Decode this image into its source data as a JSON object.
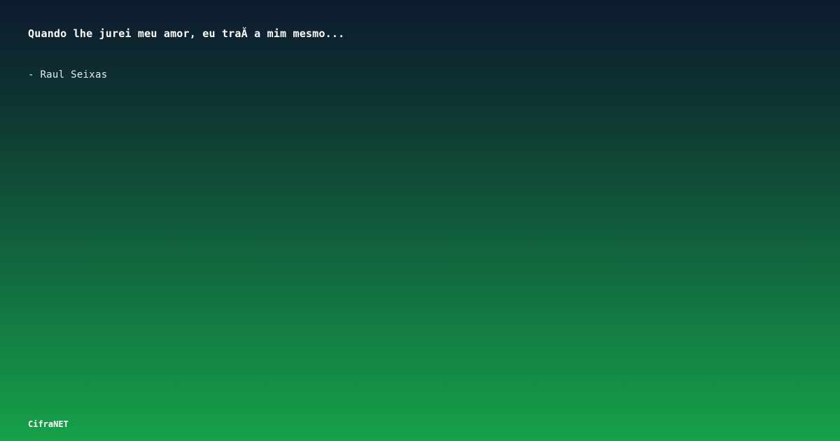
{
  "quote": {
    "text": "Quando lhe jurei meu amor, eu traĂ­ a mim mesmo..."
  },
  "author": {
    "text": "- Raul Seixas"
  },
  "brand": {
    "name": "CifraNET"
  },
  "colors": {
    "gradient_top": "#0d1a2e",
    "gradient_bottom": "#16a149",
    "text": "#ffffff"
  }
}
